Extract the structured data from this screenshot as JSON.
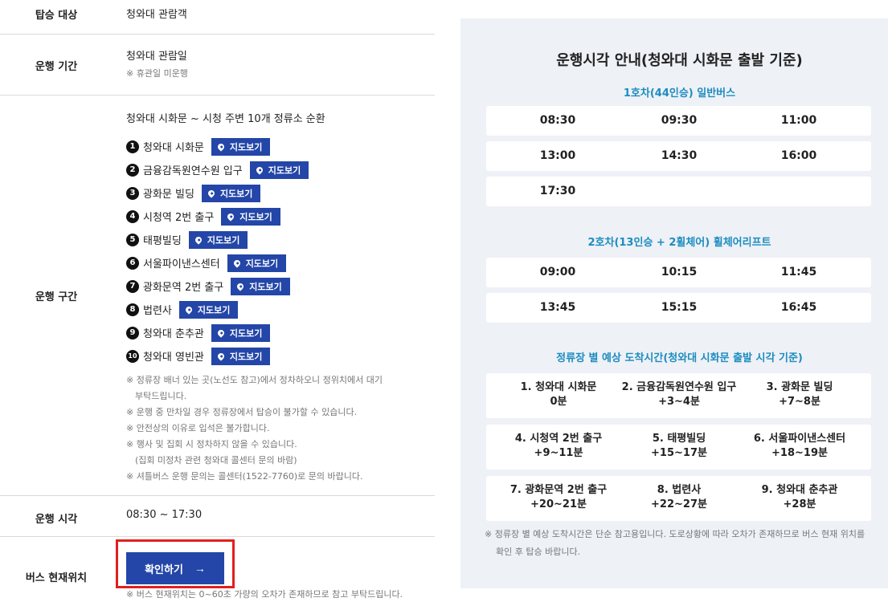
{
  "info": {
    "target": {
      "label": "탑승 대상",
      "value": "청와대 관람객"
    },
    "period": {
      "label": "운행 기간",
      "value": "청와대 관람일",
      "note": "※ 휴관일 미운행"
    },
    "route": {
      "label": "운행 구간",
      "summary": "청와대 시화문 ~ 시청 주변 10개 정류소 순환",
      "map_label": "지도보기",
      "stops": [
        {
          "num": "1",
          "name": "청와대 시화문"
        },
        {
          "num": "2",
          "name": "금융감독원연수원 입구"
        },
        {
          "num": "3",
          "name": "광화문 빌딩"
        },
        {
          "num": "4",
          "name": "시청역 2번 출구"
        },
        {
          "num": "5",
          "name": "태평빌딩"
        },
        {
          "num": "6",
          "name": "서울파이낸스센터"
        },
        {
          "num": "7",
          "name": "광화문역 2번 출구"
        },
        {
          "num": "8",
          "name": "법련사"
        },
        {
          "num": "9",
          "name": "청와대 춘추관"
        },
        {
          "num": "10",
          "name": "청와대 영빈관"
        }
      ],
      "notes": [
        "※ 정류장 배너 있는 곳(노선도 참고)에서 정차하오니 정위치에서 대기",
        "부탁드립니다.",
        "※ 운행 중 만차일 경우 정류장에서 탑승이 불가할 수 있습니다.",
        "※ 안전상의 이유로 입석은 불가합니다.",
        "※ 행사 및 집회 시 정차하지 않을 수 있습니다.",
        "(집회 미정차 관련 청와대 콜센터 문의 바람)",
        "※ 셔틀버스 운행 문의는 콜센터(1522-7760)로 문의 바랍니다."
      ]
    },
    "time": {
      "label": "운행 시각",
      "value": "08:30 ~ 17:30"
    },
    "bus": {
      "label": "버스 현재위치",
      "button": "확인하기",
      "arrow": "→",
      "note": "※ 버스 현재위치는 0~60초 가량의 오차가 존재하므로 참고 부탁드립니다."
    }
  },
  "panel": {
    "title": "운행시각 안내(청와대 시화문 출발 기준)",
    "bus1": {
      "title": "1호차(44인승) 일반버스",
      "rows": [
        [
          "08:30",
          "09:30",
          "11:00"
        ],
        [
          "13:00",
          "14:30",
          "16:00"
        ],
        [
          "17:30",
          "",
          ""
        ]
      ]
    },
    "bus2": {
      "title": "2호차(13인승 + 2휠체어) 휠체어리프트",
      "rows": [
        [
          "09:00",
          "10:15",
          "11:45"
        ],
        [
          "13:45",
          "15:15",
          "16:45"
        ]
      ]
    },
    "arrival": {
      "title": "정류장 별 예상 도착시간(청와대 시화문 출발 시각 기준)",
      "rows": [
        [
          {
            "name": "1. 청와대 시화문",
            "time": "0분"
          },
          {
            "name": "2. 금융감독원연수원 입구",
            "time": "+3~4분"
          },
          {
            "name": "3. 광화문 빌딩",
            "time": "+7~8분"
          }
        ],
        [
          {
            "name": "4. 시청역 2번 출구",
            "time": "+9~11분"
          },
          {
            "name": "5. 태평빌딩",
            "time": "+15~17분"
          },
          {
            "name": "6. 서울파이낸스센터",
            "time": "+18~19분"
          }
        ],
        [
          {
            "name": "7. 광화문역 2번 출구",
            "time": "+20~21분"
          },
          {
            "name": "8. 법련사",
            "time": "+22~27분"
          },
          {
            "name": "9. 청와대 춘추관",
            "time": "+28분"
          }
        ]
      ]
    },
    "note": [
      "※ 정류장 별 예상 도착시간은 단순 참고용입니다. 도로상황에 따라 오차가 존재하므로 버스 현재 위치를",
      "확인 후 탑승 바랍니다."
    ]
  }
}
